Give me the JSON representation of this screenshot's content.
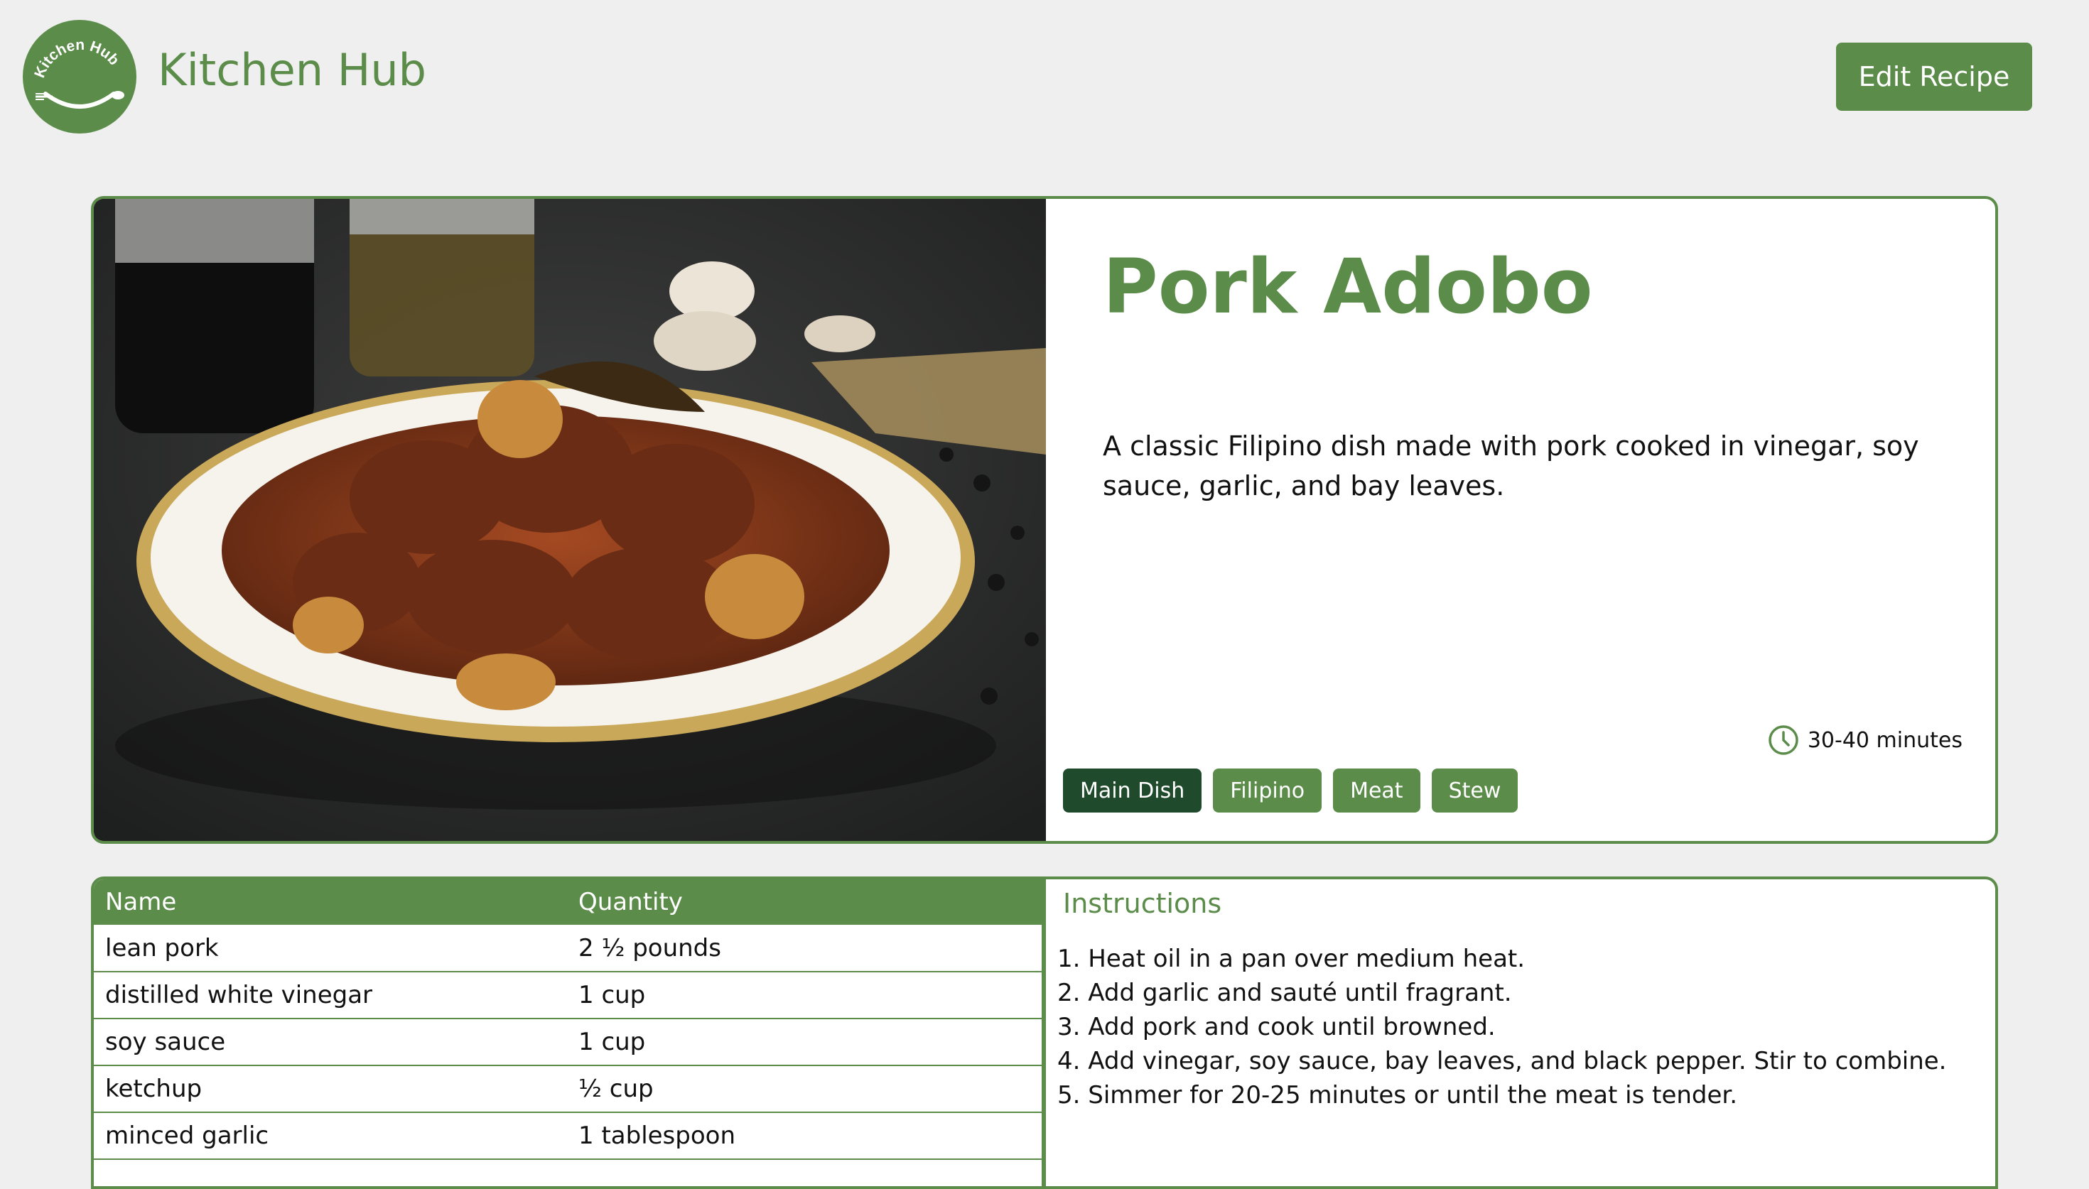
{
  "header": {
    "app_title": "Kitchen Hub",
    "logo_text": "Kitchen Hub",
    "edit_button": "Edit Recipe"
  },
  "recipe": {
    "title": "Pork Adobo",
    "description": "A classic Filipino dish made with pork cooked in vinegar, soy sauce, garlic, and bay leaves.",
    "time": "30-40 minutes",
    "tags": [
      "Main Dish",
      "Filipino",
      "Meat",
      "Stew"
    ],
    "active_tag": "Main Dish"
  },
  "ingredients": {
    "headers": [
      "Name",
      "Quantity"
    ],
    "rows": [
      [
        "lean pork",
        "2 ½ pounds"
      ],
      [
        "distilled white vinegar",
        "1 cup"
      ],
      [
        "soy sauce",
        "1 cup"
      ],
      [
        "ketchup",
        "½ cup"
      ],
      [
        "minced garlic",
        "1 tablespoon"
      ]
    ]
  },
  "instructions": {
    "title": "Instructions",
    "steps": [
      "1. Heat oil in a pan over medium heat.",
      "2. Add garlic and sauté until fragrant.",
      "3. Add pork and cook until browned.",
      "4. Add vinegar, soy sauce, bay leaves, and black pepper. Stir to combine.",
      "5. Simmer for 20-25 minutes or until the meat is tender."
    ]
  },
  "colors": {
    "brand_green": "#5b8c4a",
    "dark_green": "#1f4a2c",
    "background": "#efefef"
  },
  "icons": [
    "kitchen-hub-logo",
    "clock-icon"
  ]
}
